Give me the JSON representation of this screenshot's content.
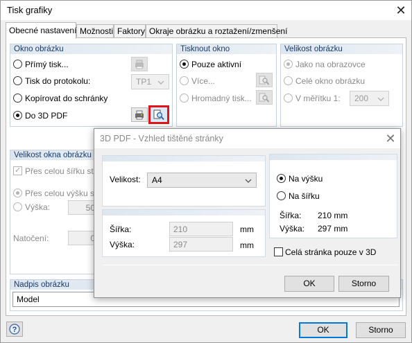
{
  "window": {
    "title": "Tisk grafiky",
    "close_glyph": "✕",
    "ok_label": "OK",
    "cancel_label": "Storno",
    "help_icon": "help-icon"
  },
  "tabs": [
    {
      "label": "Obecné nastavení",
      "active": true
    },
    {
      "label": "Možnosti",
      "active": false
    },
    {
      "label": "Faktory",
      "active": false
    },
    {
      "label": "Okraje obrázku a roztažení/zmenšení",
      "active": false
    }
  ],
  "okno_obrazku": {
    "title": "Okno obrázku",
    "options": [
      {
        "label": "Přímý tisk...",
        "checked": false
      },
      {
        "label": "Tisk do protokolu:",
        "checked": false
      },
      {
        "label": "Kopírovat do schránky",
        "checked": false
      },
      {
        "label": "Do 3D PDF",
        "checked": true
      }
    ],
    "protocol_select": "TP1"
  },
  "tisknout_okno": {
    "title": "Tisknout okno",
    "options": [
      {
        "label": "Pouze aktivní",
        "checked": true
      },
      {
        "label": "Více...",
        "checked": false
      },
      {
        "label": "Hromadný tisk...",
        "checked": false
      }
    ]
  },
  "velikost_obrazku": {
    "title": "Velikost obrázku",
    "options": [
      {
        "label": "Jako na obrazovce",
        "checked": true
      },
      {
        "label": "Celé okno obrázku",
        "checked": false
      },
      {
        "label": "V měřítku 1:",
        "checked": false
      }
    ],
    "scale_value": "200"
  },
  "velikost_okna": {
    "title": "Velikost okna obrázku a",
    "full_width_label": "Přes celou šířku strán",
    "full_height_label": "Přes celou výšku strá",
    "height_label": "Výška:",
    "height_value": "50",
    "rotation_label": "Natočení:",
    "rotation_value": "0"
  },
  "nadpis": {
    "title": "Nadpis obrázku",
    "value": "Model"
  },
  "dialog": {
    "title": "3D PDF - Vzhled tištěné stránky",
    "close_glyph": "✕",
    "size_label": "Velikost:",
    "size_value": "A4",
    "width_label": "Šířka:",
    "width_value": "210",
    "height_label": "Výška:",
    "height_value": "297",
    "unit": "mm",
    "orientation": [
      {
        "label": "Na výšku",
        "checked": true
      },
      {
        "label": "Na šířku",
        "checked": false
      }
    ],
    "info_width_label": "Šířka:",
    "info_width_value": "210 mm",
    "info_height_label": "Výška:",
    "info_height_value": "297 mm",
    "full_page_label": "Celá stránka pouze v 3D",
    "ok_label": "OK",
    "cancel_label": "Storno"
  }
}
